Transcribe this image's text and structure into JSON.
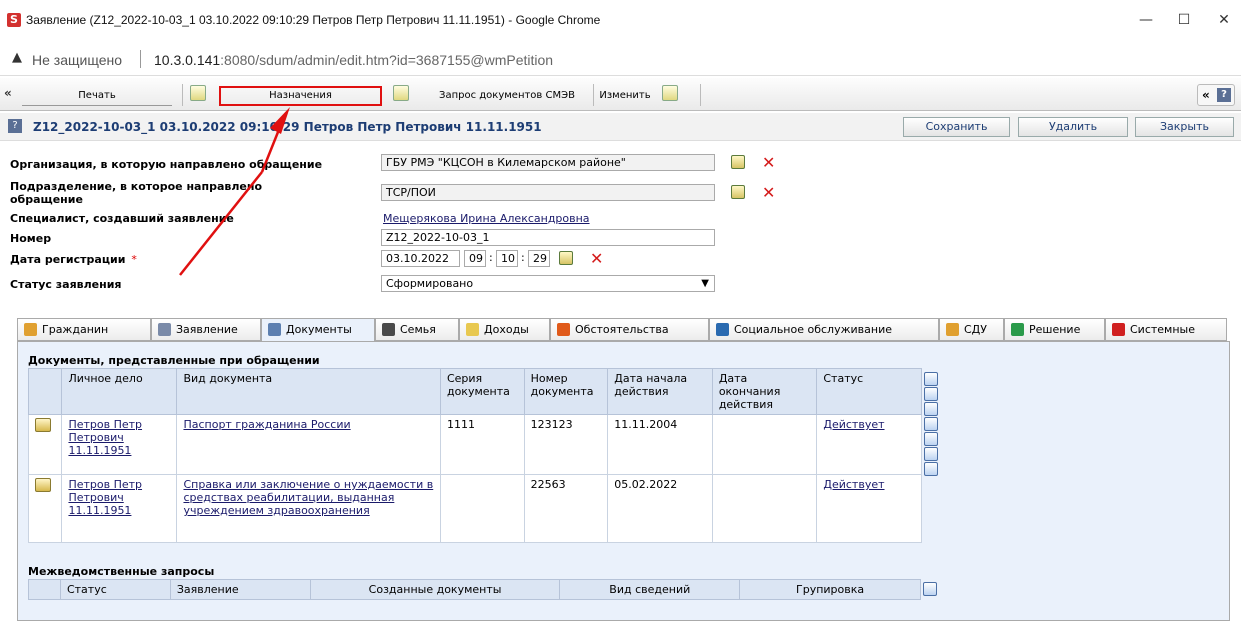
{
  "window": {
    "app_icon": "S",
    "title": "Заявление (Z12_2022-10-03_1 03.10.2022 09:10:29 Петров Петр Петрович 11.11.1951) - Google Chrome",
    "minimize": "—",
    "maximize": "☐",
    "close": "✕"
  },
  "address": {
    "warning_icon": "▲",
    "insecure": "Не защищено",
    "host": "10.3.0.141",
    "path": ":8080/sdum/admin/edit.htm?id=3687155@wmPetition"
  },
  "toolbar": {
    "collapse": "«",
    "print": "Печать",
    "assignments": "Назначения",
    "smev_request": "Запрос документов СМЭВ",
    "change": "Изменить",
    "right_arrows": "«",
    "help": "?"
  },
  "header": {
    "help": "?",
    "title": "Z12_2022-10-03_1 03.10.2022 09:10:29 Петров Петр Петрович 11.11.1951",
    "save": "Сохранить",
    "delete": "Удалить",
    "close": "Закрыть"
  },
  "form": {
    "org_label": "Организация, в которую направлено обращение",
    "org_value": "ГБУ РМЭ \"КЦСОН в Килемарском районе\"",
    "dept_label_1": "Подразделение, в которое направлено",
    "dept_label_2": "обращение",
    "dept_value": "ТСР/ПОИ",
    "specialist_label": "Специалист, создавший заявление",
    "specialist_value": "Мещерякова Ирина Александровна",
    "number_label": "Номер",
    "number_value": "Z12_2022-10-03_1",
    "reg_date_label": "Дата регистрации",
    "required_mark": "*",
    "reg_date": "03.10.2022",
    "reg_hh": "09",
    "reg_mm": "10",
    "reg_ss": "29",
    "time_sep": ":",
    "status_label": "Статус заявления",
    "status_value": "Сформировано",
    "x_mark": "✕"
  },
  "tabs": [
    {
      "label": "Гражданин",
      "color": "#e0a030"
    },
    {
      "label": "Заявление",
      "color": "#7a8aa8"
    },
    {
      "label": "Документы",
      "color": "#5c7fb0"
    },
    {
      "label": "Семья",
      "color": "#4a4a4a"
    },
    {
      "label": "Доходы",
      "color": "#e8c850"
    },
    {
      "label": "Обстоятельства",
      "color": "#e05a1a"
    },
    {
      "label": "Социальное обслуживание",
      "color": "#2a6ab0"
    },
    {
      "label": "СДУ",
      "color": "#e0a030"
    },
    {
      "label": "Решение",
      "color": "#2a9a4a"
    },
    {
      "label": "Системные",
      "color": "#d02020"
    }
  ],
  "documents": {
    "title": "Документы, представленные при обращении",
    "columns": [
      "Личное дело",
      "Вид документа",
      "Серия документа",
      "Номер документа",
      "Дата начала действия",
      "Дата окончания действия",
      "Статус"
    ],
    "rows": [
      {
        "person": "Петров Петр Петрович 11.11.1951",
        "type": "Паспорт гражданина России",
        "series": "1111",
        "number": "123123",
        "start": "11.11.2004",
        "end": "",
        "status": "Действует"
      },
      {
        "person": "Петров Петр Петрович 11.11.1951",
        "type": "Справка или заключение о нуждаемости в средствах реабилитации, выданная учреждением здравоохранения",
        "series": "",
        "number": "22563",
        "start": "05.02.2022",
        "end": "",
        "status": "Действует"
      }
    ]
  },
  "interdept": {
    "title": "Межведомственные запросы",
    "columns": [
      "Статус",
      "Заявление",
      "Созданные документы",
      "Вид сведений",
      "Групировка"
    ]
  }
}
